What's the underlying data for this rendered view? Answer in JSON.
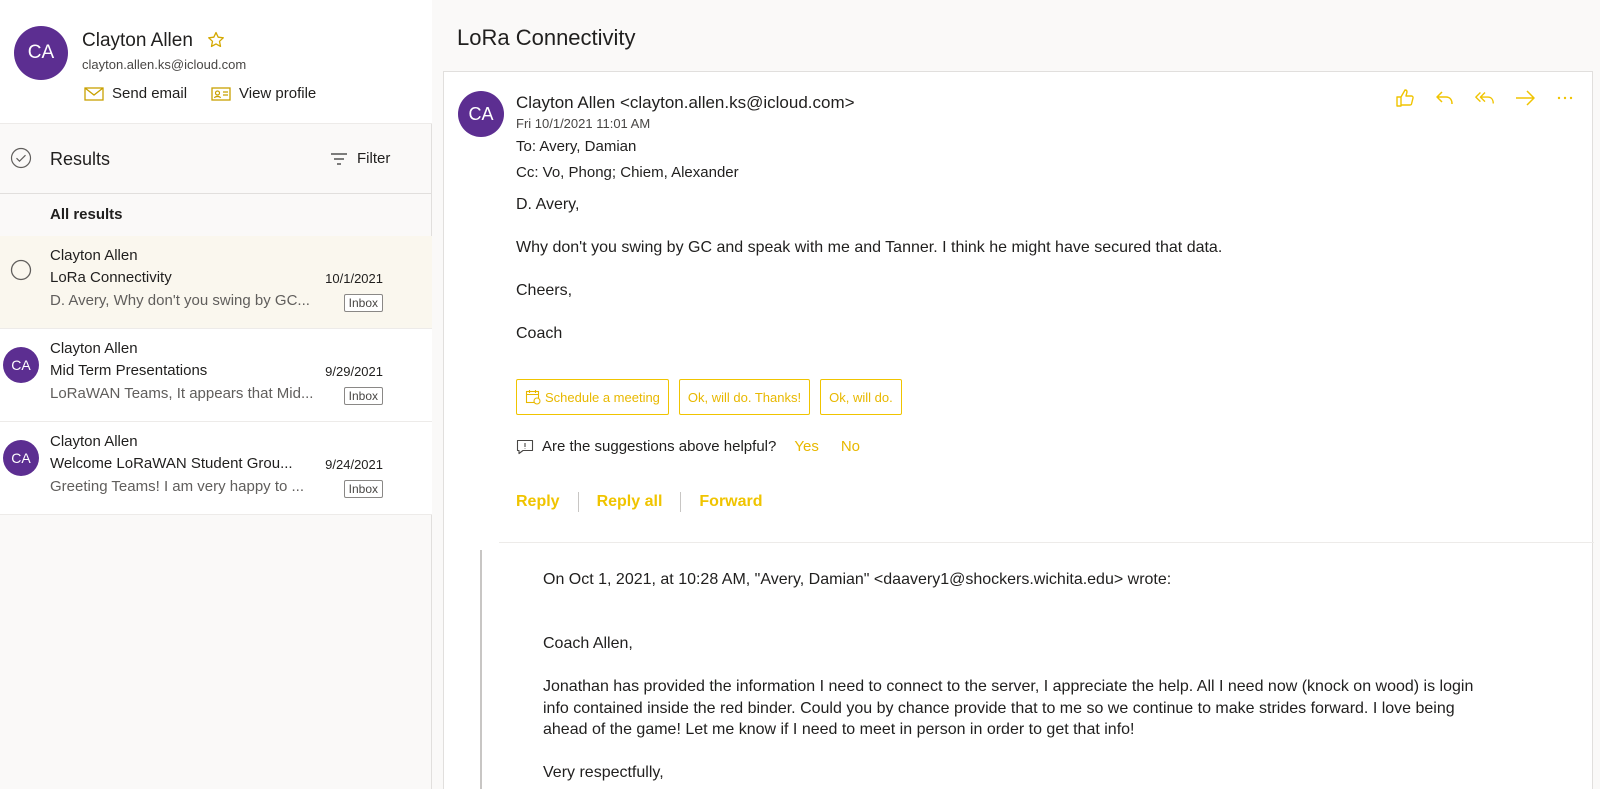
{
  "profile": {
    "initials": "CA",
    "name": "Clayton Allen",
    "email": "clayton.allen.ks@icloud.com",
    "send_email_label": "Send email",
    "view_profile_label": "View profile"
  },
  "results": {
    "title": "Results",
    "filter_label": "Filter",
    "section_label": "All results"
  },
  "mail_list": [
    {
      "initials": "CA",
      "sender": "Clayton Allen",
      "subject": "LoRa Connectivity",
      "date": "10/1/2021",
      "preview": "D. Avery, Why don't you swing by GC...",
      "badge": "Inbox"
    },
    {
      "initials": "CA",
      "sender": "Clayton Allen",
      "subject": "Mid Term Presentations",
      "date": "9/29/2021",
      "preview": "LoRaWAN Teams, It appears that Mid...",
      "badge": "Inbox"
    },
    {
      "initials": "CA",
      "sender": "Clayton Allen",
      "subject": "Welcome LoRaWAN Student Grou...",
      "date": "9/24/2021",
      "preview": "Greeting Teams! I am very happy to ...",
      "badge": "Inbox"
    }
  ],
  "message": {
    "conversation_title": "LoRa Connectivity",
    "initials": "CA",
    "from": "Clayton Allen <clayton.allen.ks@icloud.com>",
    "sent": "Fri 10/1/2021 11:01 AM",
    "to": "To:  Avery, Damian",
    "cc": "Cc:  Vo, Phong;  Chiem, Alexander",
    "body": [
      "D. Avery,",
      "Why don't you swing by GC and speak with me and Tanner. I think he might have secured that data.",
      "Cheers,",
      "Coach"
    ],
    "suggestions": [
      "Schedule a meeting",
      "Ok, will do. Thanks!",
      "Ok, will do."
    ],
    "helpful_question": "Are the suggestions above helpful?",
    "helpful_yes": "Yes",
    "helpful_no": "No",
    "reply_label": "Reply",
    "reply_all_label": "Reply all",
    "forward_label": "Forward",
    "quoted": {
      "header": "On Oct 1, 2021, at 10:28 AM, \"Avery, Damian\" <daavery1@shockers.wichita.edu> wrote:",
      "greeting": "Coach Allen,",
      "body": "Jonathan has provided the information I need to connect to the server, I appreciate the help. All I need now (knock on wood) is login info contained inside the red binder. Could you by chance provide that to me so we continue to make strides forward. I love being ahead of the game! Let me know if I need to meet in person in order to get that info!",
      "closing": "Very respectfully,"
    }
  },
  "colors": {
    "avatar": "#5c2e91",
    "accent": "#f0c400",
    "selected_row": "#faf7ee"
  }
}
